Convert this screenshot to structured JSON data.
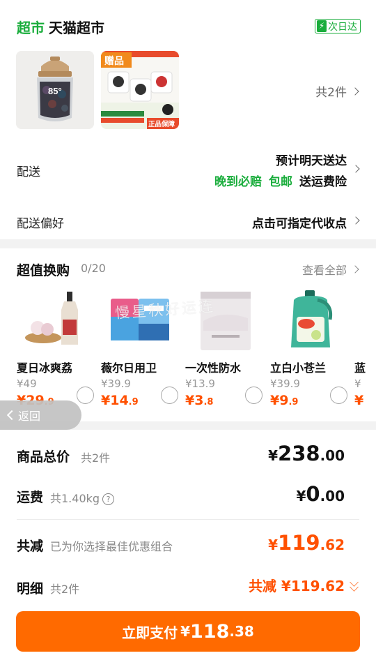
{
  "store": {
    "tag": "超市",
    "name": "天猫超市",
    "nextday_label": "次日达",
    "bolt": "⚡"
  },
  "items": {
    "gift_badge": "赠品",
    "thumb1_text": "85°",
    "thumb2_tag": "正品保障",
    "count_label": "共2件"
  },
  "delivery": {
    "label": "配送",
    "eta": "预计明天送达",
    "promises": [
      "晚到必赔",
      "包邮",
      "送运费险"
    ],
    "pref_label": "配送偏好",
    "pref_value": "点击可指定代收点"
  },
  "swap": {
    "title": "超值换购",
    "count": "0/20",
    "see_all": "查看全部",
    "products": [
      {
        "name": "夏日冰爽荔",
        "orig": "¥49",
        "now_int": "¥29",
        "now_dec": ".9"
      },
      {
        "name": "薇尔日用卫",
        "orig": "¥39.9",
        "now_int": "¥14",
        "now_dec": ".9"
      },
      {
        "name": "一次性防水",
        "orig": "¥13.9",
        "now_int": "¥3",
        "now_dec": ".8"
      },
      {
        "name": "立白小苍兰",
        "orig": "¥39.9",
        "now_int": "¥9",
        "now_dec": ".9"
      },
      {
        "name": "蓝",
        "orig": "¥",
        "now_int": "¥",
        "now_dec": ""
      }
    ],
    "watermark": "慢星秋好运连"
  },
  "back_button": {
    "label": "返回"
  },
  "summary": {
    "total_label": "商品总价",
    "total_count": "共2件",
    "total_cur": "¥",
    "total_int": "238",
    "total_dec": ".00",
    "shipping_label": "运费",
    "shipping_weight": "共1.40kg",
    "help_glyph": "?",
    "shipping_cur": "¥",
    "shipping_int": "0",
    "shipping_dec": ".00",
    "discount_label": "共减",
    "discount_note": "已为你选择最佳优惠组合",
    "discount_cur": "¥",
    "discount_int": "119",
    "discount_dec": ".62",
    "detail_label": "明细",
    "detail_count": "共2件",
    "detail_value": "共减 ¥119.62"
  },
  "pay": {
    "label": "立即支付",
    "cur": "¥",
    "int": "118",
    "dec": ".38"
  },
  "colors": {
    "accent_green": "#1aad3c",
    "accent_orange": "#ff5000",
    "pay_button": "#ff6a00"
  }
}
